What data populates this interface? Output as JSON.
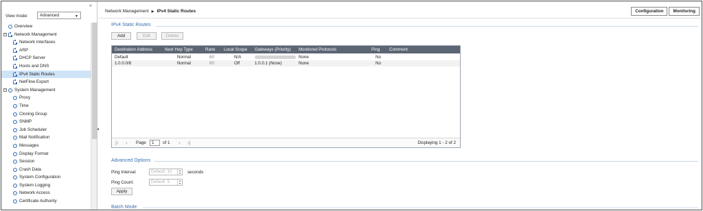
{
  "sidebar": {
    "view_mode_label": "View mode:",
    "view_mode_value": "Advanced",
    "tree": [
      {
        "label": "Overview",
        "level": 0,
        "icon": "overview-icon"
      },
      {
        "label": "Network Management",
        "level": 0,
        "icon": "network-icon",
        "expander": "minus"
      },
      {
        "label": "Network Interfaces",
        "level": 1,
        "icon": "network-icon"
      },
      {
        "label": "ARP",
        "level": 1,
        "icon": "network-icon"
      },
      {
        "label": "DHCP Server",
        "level": 1,
        "icon": "network-icon"
      },
      {
        "label": "Hosts and DNS",
        "level": 1,
        "icon": "network-icon"
      },
      {
        "label": "IPv4 Static Routes",
        "level": 1,
        "icon": "network-icon",
        "selected": true
      },
      {
        "label": "NetFlow Export",
        "level": 1,
        "icon": "network-icon"
      },
      {
        "label": "System Management",
        "level": 0,
        "icon": "gear-icon",
        "expander": "minus"
      },
      {
        "label": "Proxy",
        "level": 1,
        "icon": "gear-icon"
      },
      {
        "label": "Time",
        "level": 1,
        "icon": "gear-icon"
      },
      {
        "label": "Cloning Group",
        "level": 1,
        "icon": "gear-icon"
      },
      {
        "label": "SNMP",
        "level": 1,
        "icon": "gear-icon"
      },
      {
        "label": "Job Scheduler",
        "level": 1,
        "icon": "gear-icon"
      },
      {
        "label": "Mail Notification",
        "level": 1,
        "icon": "gear-icon"
      },
      {
        "label": "Messages",
        "level": 1,
        "icon": "gear-icon"
      },
      {
        "label": "Display Format",
        "level": 1,
        "icon": "gear-icon"
      },
      {
        "label": "Session",
        "level": 1,
        "icon": "gear-icon"
      },
      {
        "label": "Crash Data",
        "level": 1,
        "icon": "gear-icon"
      },
      {
        "label": "System Configuration",
        "level": 1,
        "icon": "gear-icon"
      },
      {
        "label": "System Logging",
        "level": 1,
        "icon": "gear-icon"
      },
      {
        "label": "Network Access",
        "level": 1,
        "icon": "gear-icon"
      },
      {
        "label": "Certificate Authority",
        "level": 1,
        "icon": "gear-icon"
      }
    ]
  },
  "header": {
    "breadcrumb_parent": "Network Management",
    "breadcrumb_current": "IPv4 Static Routes",
    "tabs": [
      "Configuration",
      "Monitoring"
    ]
  },
  "routes": {
    "section_title": "IPv4 Static Routes",
    "buttons": {
      "add": "Add",
      "edit": "Edit",
      "delete": "Delete"
    },
    "columns": [
      "Destination Address",
      "Next Hop Type",
      "Rank",
      "Local Scope",
      "Gateways (Priority)",
      "Monitored Protocols",
      "Ping",
      "Comment"
    ],
    "rows": [
      {
        "dest": "Default",
        "hop": "Normal",
        "rank": "60",
        "scope": "N/A",
        "gateways": "",
        "protocols": "None",
        "ping": "No",
        "comment": ""
      },
      {
        "dest": "1.0.0.0/8",
        "hop": "Normal",
        "rank": "60",
        "scope": "Off",
        "gateways": "1.0.0.1 (None)",
        "protocols": "None",
        "ping": "No",
        "comment": ""
      }
    ],
    "pager": {
      "page_label": "Page",
      "page_value": "1",
      "of_label": "of 1",
      "display": "Displaying 1 - 2 of 2"
    }
  },
  "advanced": {
    "section_title": "Advanced Options",
    "ping_interval_label": "Ping Interval:",
    "ping_interval_placeholder": "Default: 10",
    "ping_interval_unit": "seconds",
    "ping_count_label": "Ping Count:",
    "ping_count_placeholder": "Default: 5",
    "apply": "Apply"
  },
  "batch": {
    "section_title": "Batch Mode"
  },
  "colors": {
    "accent": "#3a6fb0",
    "grid_header": "#5b6573",
    "selected_row": "#cfe3f7"
  }
}
